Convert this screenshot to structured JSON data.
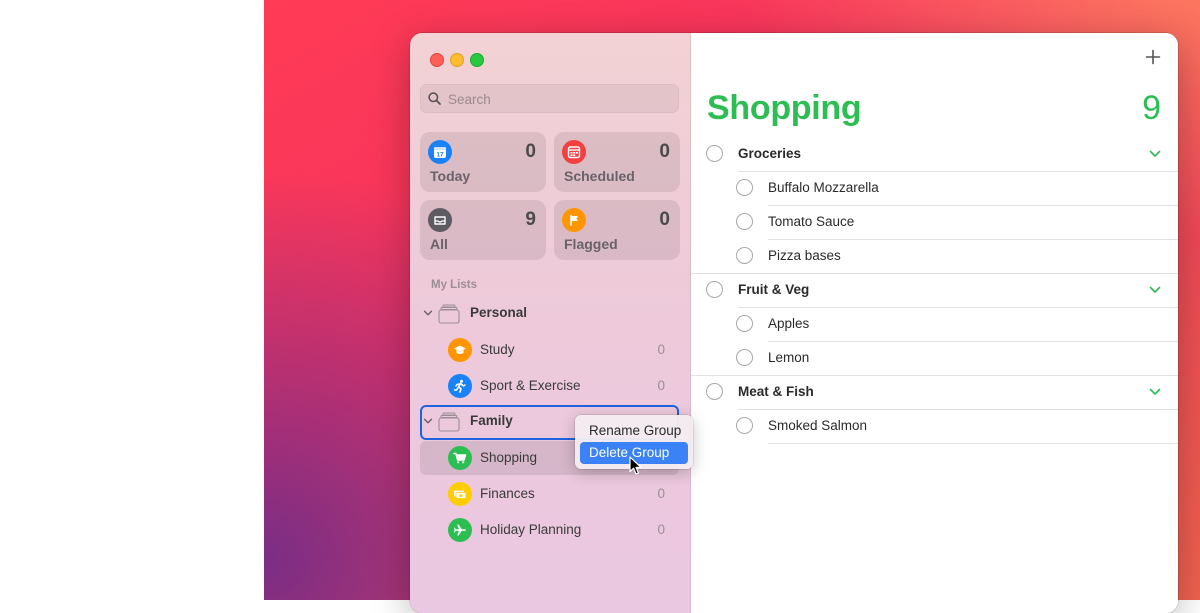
{
  "search": {
    "placeholder": "Search"
  },
  "smart_lists": [
    {
      "label": "Today",
      "count": "0",
      "icon": "calendar-icon",
      "color": "#1a82f7"
    },
    {
      "label": "Scheduled",
      "count": "0",
      "icon": "calendar-grid-icon",
      "color": "#f23f3f"
    },
    {
      "label": "All",
      "count": "9",
      "icon": "tray-icon",
      "color": "#5c5c62"
    },
    {
      "label": "Flagged",
      "count": "0",
      "icon": "flag-icon",
      "color": "#ff9500"
    }
  ],
  "today_icon_day": "17",
  "my_lists_title": "My Lists",
  "groups": [
    {
      "name": "Personal",
      "lists": [
        {
          "name": "Study",
          "count": "0",
          "icon": "graduation-cap-icon",
          "color": "#ff9500"
        },
        {
          "name": "Sport & Exercise",
          "count": "0",
          "icon": "running-figure-icon",
          "color": "#1a82f7"
        }
      ]
    },
    {
      "name": "Family",
      "lists": [
        {
          "name": "Shopping",
          "count": "",
          "icon": "cart-icon",
          "color": "#2dbe53"
        },
        {
          "name": "Finances",
          "count": "0",
          "icon": "money-icon",
          "color": "#ffcc00"
        },
        {
          "name": "Holiday Planning",
          "count": "0",
          "icon": "airplane-icon",
          "color": "#2dbe53"
        }
      ]
    }
  ],
  "context_menu": {
    "items": [
      "Rename Group",
      "Delete Group"
    ],
    "highlighted": "Delete Group"
  },
  "main": {
    "title": "Shopping",
    "count": "9",
    "accent": "#2dbe53",
    "sections": [
      {
        "title": "Groceries",
        "items": [
          "Buffalo Mozzarella",
          "Tomato Sauce",
          "Pizza bases"
        ]
      },
      {
        "title": "Fruit & Veg",
        "items": [
          "Apples",
          "Lemon"
        ]
      },
      {
        "title": "Meat & Fish",
        "items": [
          "Smoked Salmon"
        ]
      }
    ]
  }
}
